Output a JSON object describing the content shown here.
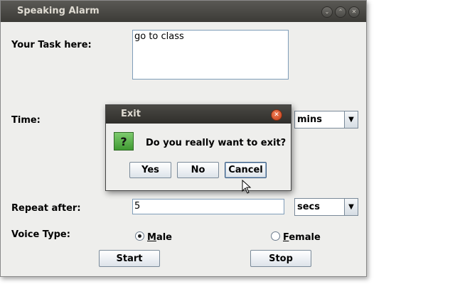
{
  "window": {
    "title": "Speaking Alarm",
    "controls": [
      "minimize",
      "maximize",
      "close"
    ]
  },
  "form": {
    "task_label": "Your Task here:",
    "task_value": "go to class",
    "time_label": "Time:",
    "time_unit": "mins",
    "repeat_label": "Repeat after:",
    "repeat_value": "5",
    "repeat_unit": "secs",
    "voice_label": "Voice Type:",
    "voice_options": [
      {
        "label": "Male",
        "mnemonic": "M",
        "rest": "ale",
        "checked": true
      },
      {
        "label": "Female",
        "mnemonic": "F",
        "rest": "emale",
        "checked": false
      }
    ],
    "start_label": "Start",
    "stop_label": "Stop"
  },
  "dialog": {
    "title": "Exit",
    "icon": "question-icon",
    "icon_glyph": "?",
    "message": "Do you really want to exit?",
    "buttons": {
      "yes": "Yes",
      "no": "No",
      "cancel": "Cancel"
    }
  },
  "colors": {
    "titlebar": "#3c3b37",
    "window_bg": "#eeeeec",
    "close_button": "#e05a2b",
    "question_icon": "#4fae3f"
  }
}
